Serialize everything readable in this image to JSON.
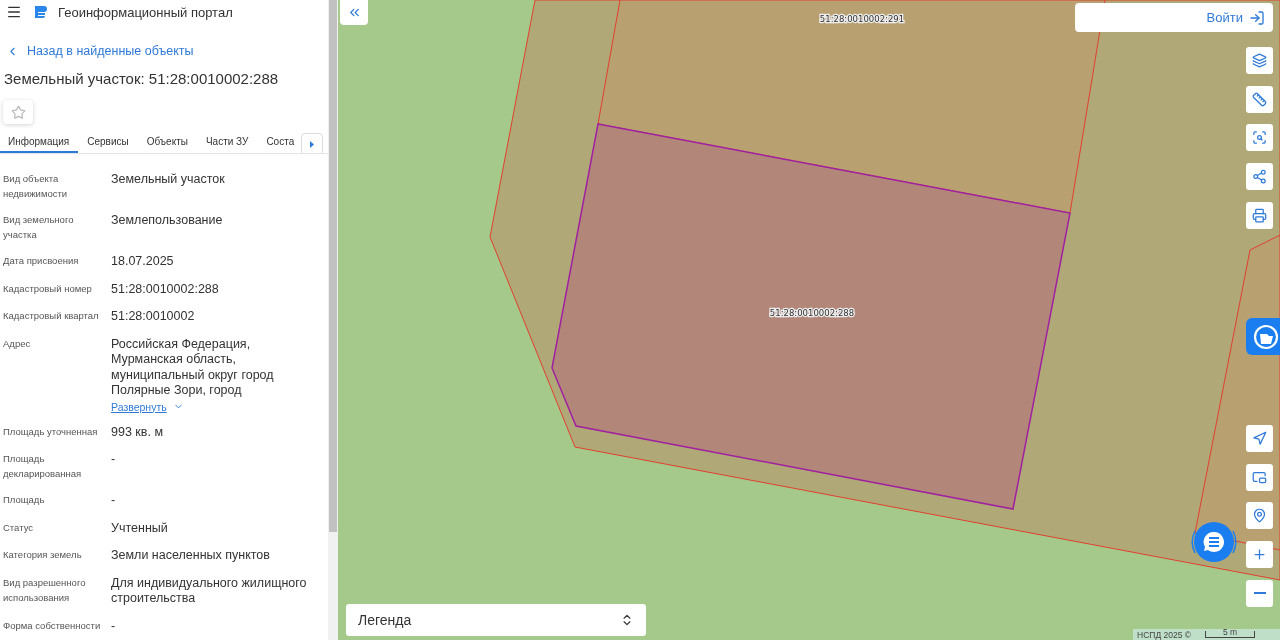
{
  "header": {
    "title": "Геоинформационный портал"
  },
  "back_link": "Назад в найденные объекты",
  "object_title": "Земельный участок: 51:28:0010002:288",
  "favorite": {
    "on": false
  },
  "tabs": [
    {
      "label": "Информация",
      "selected": true
    },
    {
      "label": "Сервисы",
      "selected": false
    },
    {
      "label": "Объекты",
      "selected": false
    },
    {
      "label": "Части ЗУ",
      "selected": false
    },
    {
      "label": "Соста",
      "selected": false
    }
  ],
  "fields": [
    {
      "label": "Вид объекта недвижимости",
      "value": "Земельный участок"
    },
    {
      "label": "Вид земельного участка",
      "value": "Землепользование"
    },
    {
      "label": "Дата присвоения",
      "value": "18.07.2025"
    },
    {
      "label": "Кадастровый номер",
      "value": "51:28:0010002:288"
    },
    {
      "label": "Кадастровый квартал",
      "value": "51:28:0010002"
    },
    {
      "label": "Адрес",
      "value": "Российская Федерация, Мурманская область, муниципальный округ город Полярные Зори, город",
      "expand_link": "Развернуть"
    },
    {
      "label": "Площадь уточненная",
      "value": "993 кв. м"
    },
    {
      "label": "Площадь декларированная",
      "value": "-"
    },
    {
      "label": "Площадь",
      "value": "-"
    },
    {
      "label": "Статус",
      "value": "Учтенный"
    },
    {
      "label": "Категория земель",
      "value": "Земли населенных пунктов"
    },
    {
      "label": "Вид разрешенного использования",
      "value": "Для индивидуального жилищного строительства"
    },
    {
      "label": "Форма собственности",
      "value": "-"
    }
  ],
  "map": {
    "parcels": [
      {
        "label": "51:28:0010002:291",
        "selected": false
      },
      {
        "label": "51:28:0010002:288",
        "selected": true
      }
    ],
    "login": "Войти",
    "legend": "Легенда",
    "attribution": "НСПД 2025 ©",
    "scale": "5 m"
  }
}
